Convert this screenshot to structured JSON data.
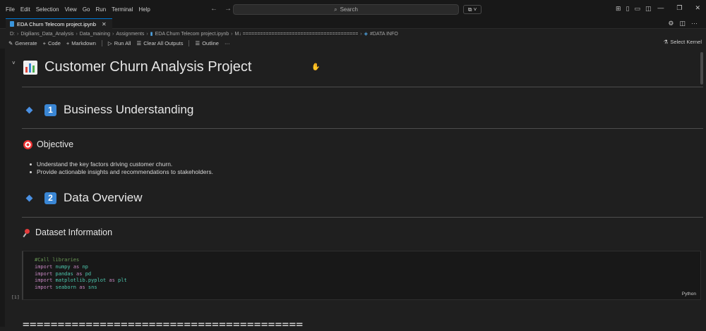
{
  "menu": [
    "File",
    "Edit",
    "Selection",
    "View",
    "Go",
    "Run",
    "Terminal",
    "Help"
  ],
  "search": {
    "placeholder": "Search"
  },
  "tab": {
    "title": "EDA Churn Telecom project.ipynb"
  },
  "breadcrumb": [
    "D:",
    "Digilians_Data_Analysis",
    "Data_maining",
    "Assignments",
    "EDA Churn Telecom project.ipynb",
    "M↓ ========================================",
    "#DATA INFO"
  ],
  "toolbar": {
    "generate": "Generate",
    "code": "Code",
    "markdown": "Markdown",
    "run_all": "Run All",
    "clear_outputs": "Clear All Outputs",
    "outline": "Outline",
    "more": "···",
    "select_kernel": "Select Kernel"
  },
  "notebook": {
    "title": "Customer Churn Analysis Project",
    "section1": {
      "number": "1",
      "title": "Business Understanding"
    },
    "objective": {
      "title": "Objective",
      "bullets": [
        "Understand the key factors driving customer churn.",
        "Provide actionable insights and recommendations to stakeholders."
      ]
    },
    "section2": {
      "number": "2",
      "title": "Data Overview"
    },
    "dataset_info": {
      "title": "Dataset Information"
    },
    "code_cell": {
      "comment": "#Call libraries",
      "lines": [
        {
          "kw": "import",
          "mod": "numpy",
          "as": "as",
          "alias": "np"
        },
        {
          "kw": "import",
          "mod": "pandas",
          "as": "as",
          "alias": "pd"
        },
        {
          "kw": "import",
          "mod": "matplotlib.pyplot",
          "as": "as",
          "alias": "plt"
        },
        {
          "kw": "import",
          "mod": "seaborn",
          "as": "as",
          "alias": "sns"
        }
      ],
      "language": "Python",
      "exec_count": "[1]"
    },
    "separator": "========================================"
  }
}
